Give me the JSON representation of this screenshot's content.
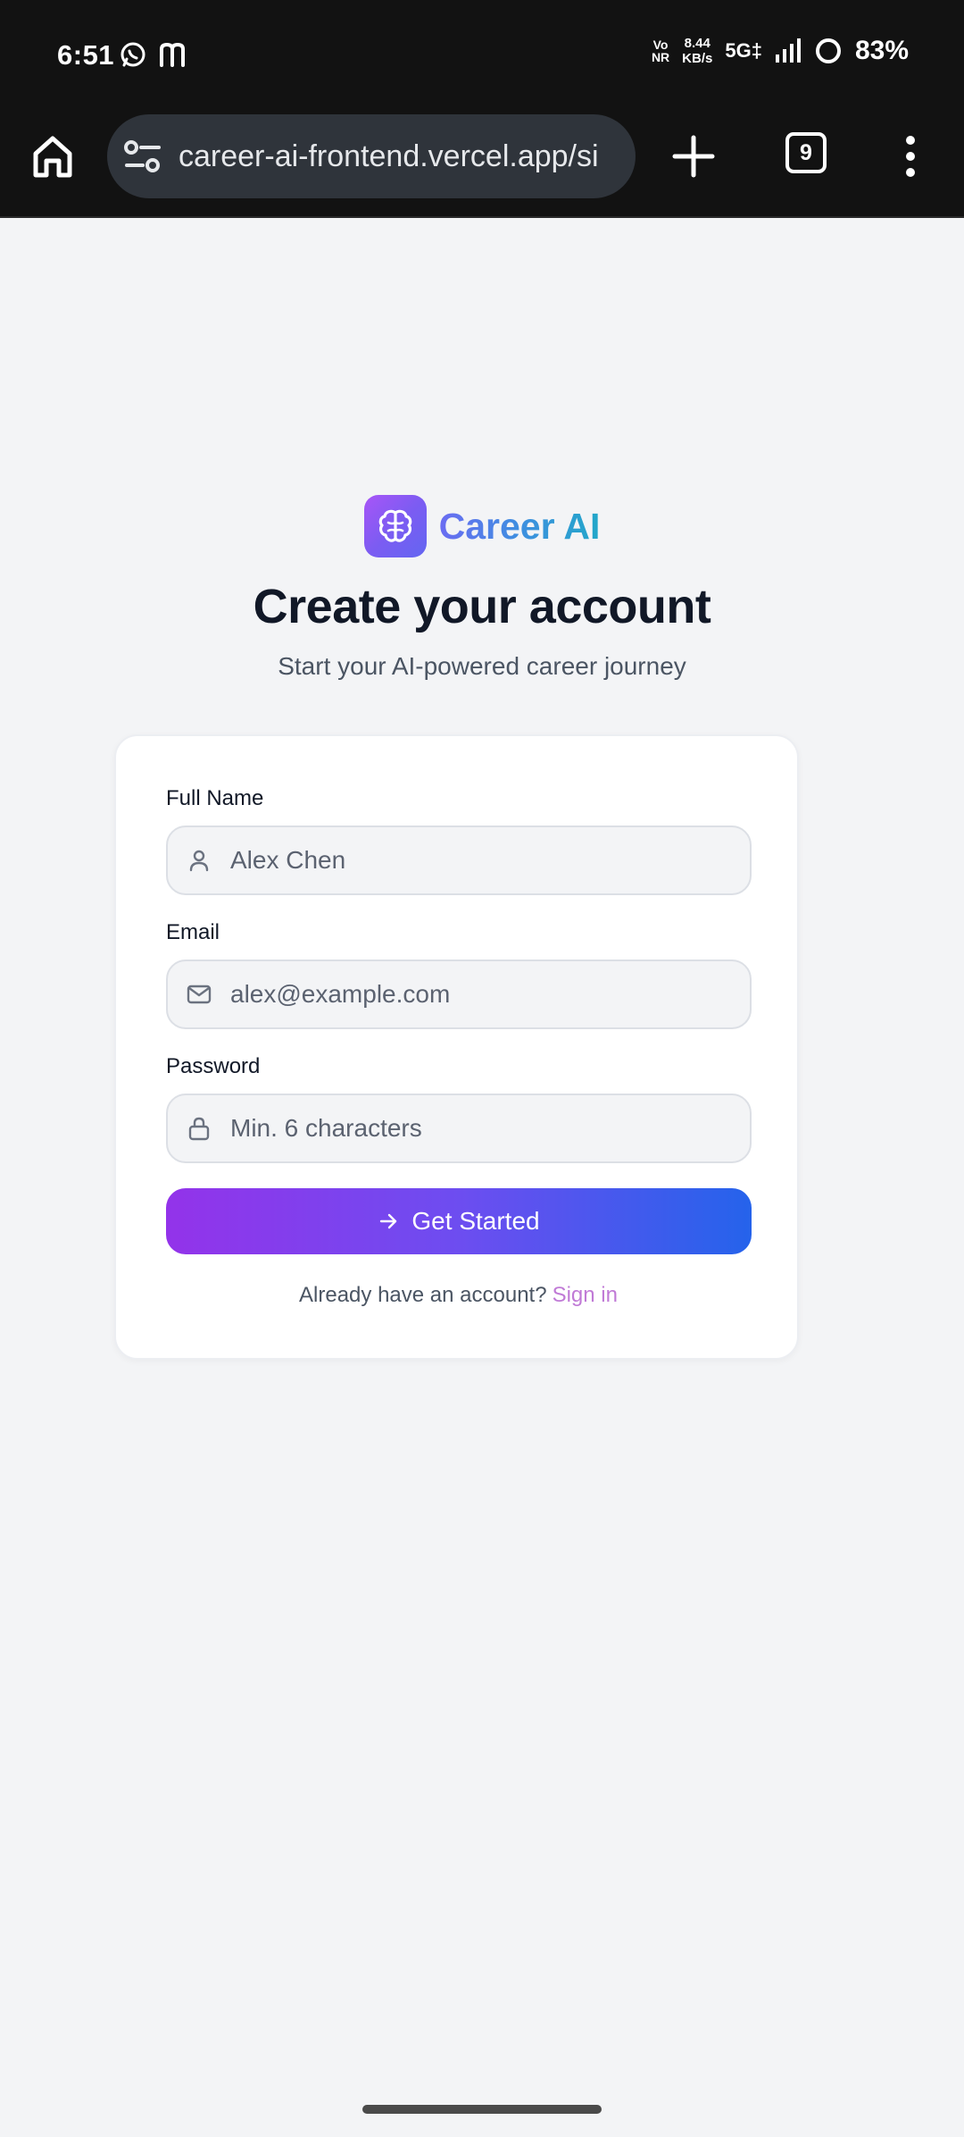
{
  "status_bar": {
    "time": "6:51",
    "left_icons": [
      "whatsapp-icon",
      "threads-icon"
    ],
    "volte_top": "Vo",
    "volte_bottom": "NR",
    "net_speed_value": "8.44",
    "net_speed_unit": "KB/s",
    "network_type": "5G‡",
    "battery_percent": "83%"
  },
  "browser": {
    "url": "career-ai-frontend.vercel.app/si",
    "tab_count": "9",
    "icons": [
      "home-icon",
      "site-settings-icon",
      "new-tab-plus-icon",
      "tabs-icon",
      "more-vert-icon"
    ]
  },
  "brand": {
    "name": "Career AI",
    "logo_icon": "brain-icon"
  },
  "page": {
    "title": "Create your account",
    "subtitle": "Start your AI-powered career journey"
  },
  "form": {
    "full_name": {
      "label": "Full Name",
      "placeholder": "Alex Chen",
      "icon": "user-icon"
    },
    "email": {
      "label": "Email",
      "placeholder": "alex@example.com",
      "icon": "mail-icon"
    },
    "password": {
      "label": "Password",
      "placeholder": "Min. 6 characters",
      "icon": "lock-icon"
    },
    "submit_label": "Get Started",
    "submit_icon": "arrow-right-icon",
    "signin_prompt": "Already have an account?",
    "signin_link": "Sign in"
  },
  "colors": {
    "brand_gradient_start": "#9333ea",
    "brand_gradient_end": "#2563eb",
    "link": "#c07ad6",
    "background": "#f3f4f6"
  }
}
